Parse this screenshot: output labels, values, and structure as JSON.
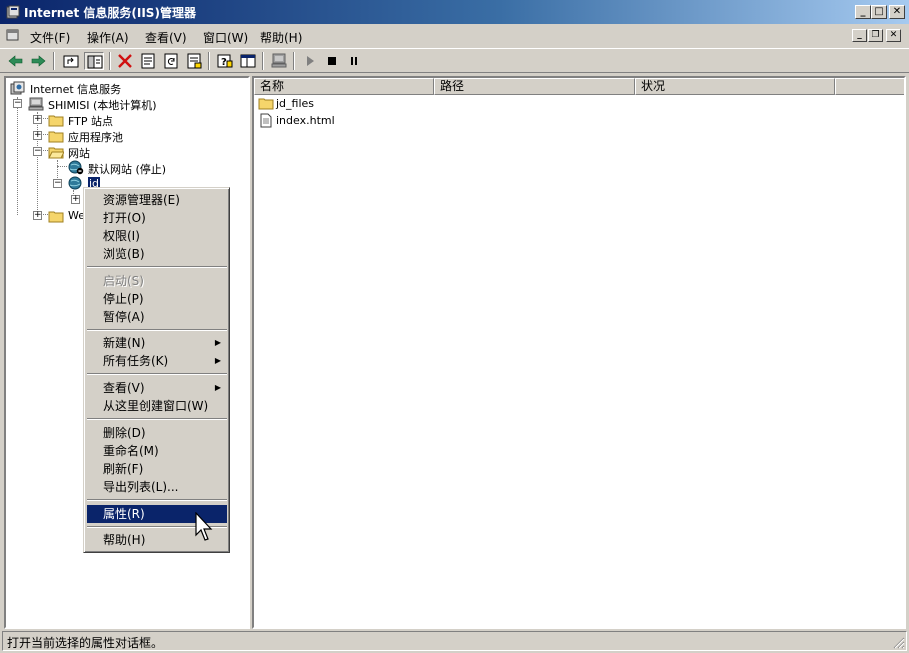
{
  "window": {
    "title": "Internet 信息服务(IIS)管理器"
  },
  "menubar": {
    "items": [
      "文件(F)",
      "操作(A)",
      "查看(V)",
      "窗口(W)",
      "帮助(H)"
    ]
  },
  "toolbar": {
    "icons": [
      "back-arrow-icon",
      "forward-arrow-icon",
      "up-folder-icon",
      "show-hide-tree-icon",
      "delete-x-icon",
      "properties-icon",
      "refresh-icon",
      "export-list-icon",
      "help-icon",
      "console-icon",
      "computer-icon",
      "play-icon",
      "stop-icon",
      "pause-icon"
    ]
  },
  "tree": {
    "root": "Internet 信息服务",
    "computer": "SHIMISI (本地计算机)",
    "ftp": "FTP 站点",
    "apppools": "应用程序池",
    "websites": "网站",
    "default_site": "默认网站 (停止)",
    "jd_site": "jd",
    "web_ext": "Web"
  },
  "list": {
    "columns": [
      "名称",
      "路径",
      "状况"
    ],
    "rows": [
      {
        "name": "jd_files",
        "icon": "folder-icon"
      },
      {
        "name": "index.html",
        "icon": "document-icon"
      }
    ]
  },
  "context_menu": {
    "explorer": "资源管理器(E)",
    "open": "打开(O)",
    "permissions": "权限(I)",
    "browse": "浏览(B)",
    "start": "启动(S)",
    "stop": "停止(P)",
    "pause": "暂停(A)",
    "new": "新建(N)",
    "all_tasks": "所有任务(K)",
    "view": "查看(V)",
    "new_window": "从这里创建窗口(W)",
    "delete": "删除(D)",
    "rename": "重命名(M)",
    "refresh": "刷新(F)",
    "export": "导出列表(L)...",
    "properties": "属性(R)",
    "help": "帮助(H)"
  },
  "statusbar": {
    "text": "打开当前选择的属性对话框。"
  },
  "colors": {
    "titlebar_start": "#0a246a",
    "titlebar_end": "#a6caf0",
    "face": "#d4d0c8",
    "highlight": "#0a246a"
  }
}
